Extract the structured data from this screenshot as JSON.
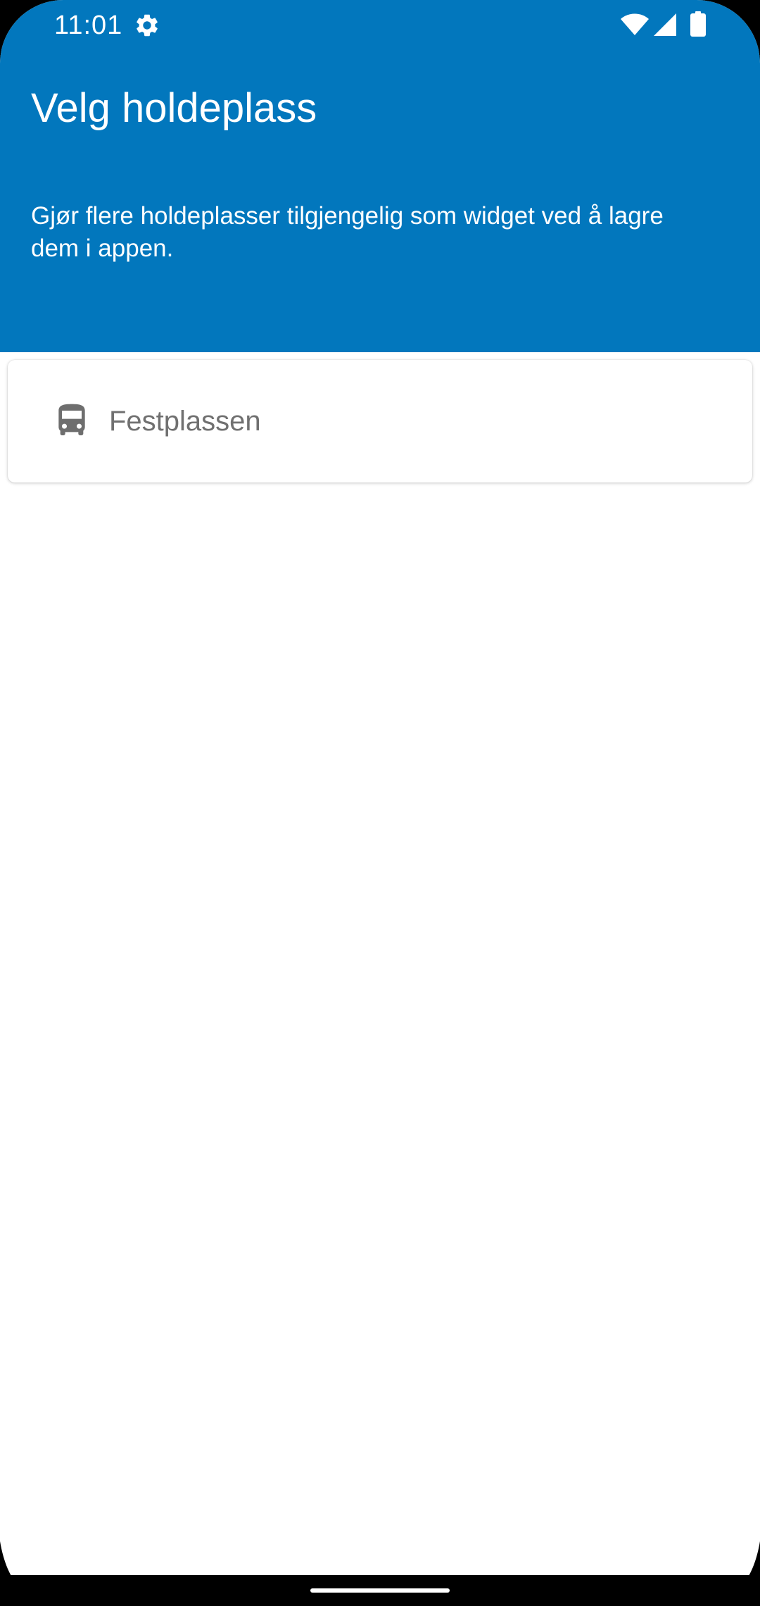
{
  "status_bar": {
    "time": "11:01",
    "icons": [
      "gear-icon",
      "wifi-icon",
      "cell-signal-icon",
      "battery-icon"
    ]
  },
  "header": {
    "title": "Velg holdeplass",
    "subtitle": "Gjør flere holdeplasser tilgjengelig som widget ved å lagre dem i appen."
  },
  "stops": [
    {
      "name": "Festplassen",
      "icon": "bus-icon"
    }
  ],
  "colors": {
    "header_background": "#0277bd",
    "header_text": "#ffffff",
    "stop_text": "#707070",
    "icon_gray": "#6e6e6e"
  }
}
